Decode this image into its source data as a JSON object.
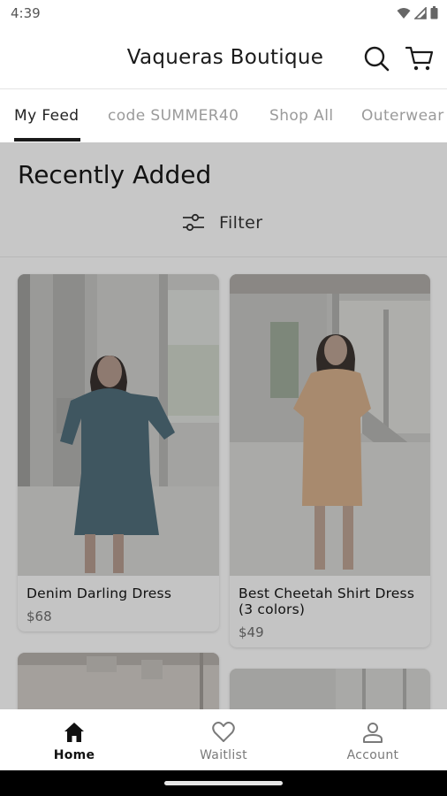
{
  "status_bar": {
    "time": "4:39"
  },
  "header": {
    "title": "Vaqueras Boutique"
  },
  "tabs": [
    {
      "label": "My Feed",
      "active": true
    },
    {
      "label": "code SUMMER40"
    },
    {
      "label": "Shop All"
    },
    {
      "label": "Outerwear"
    }
  ],
  "section": {
    "title": "Recently Added",
    "filter_label": "Filter"
  },
  "products": [
    {
      "name": "Denim Darling Dress",
      "price": "$68"
    },
    {
      "name": "Best Cheetah Shirt Dress (3 colors)",
      "price": "$49"
    }
  ],
  "bottom_nav": [
    {
      "label": "Home",
      "icon": "home-icon",
      "active": true
    },
    {
      "label": "Waitlist",
      "icon": "heart-icon"
    },
    {
      "label": "Account",
      "icon": "account-icon"
    }
  ],
  "colors": {
    "overlay_gray": "#c7c7c7",
    "active_text": "#111111",
    "inactive_text": "#9a9a9a"
  }
}
